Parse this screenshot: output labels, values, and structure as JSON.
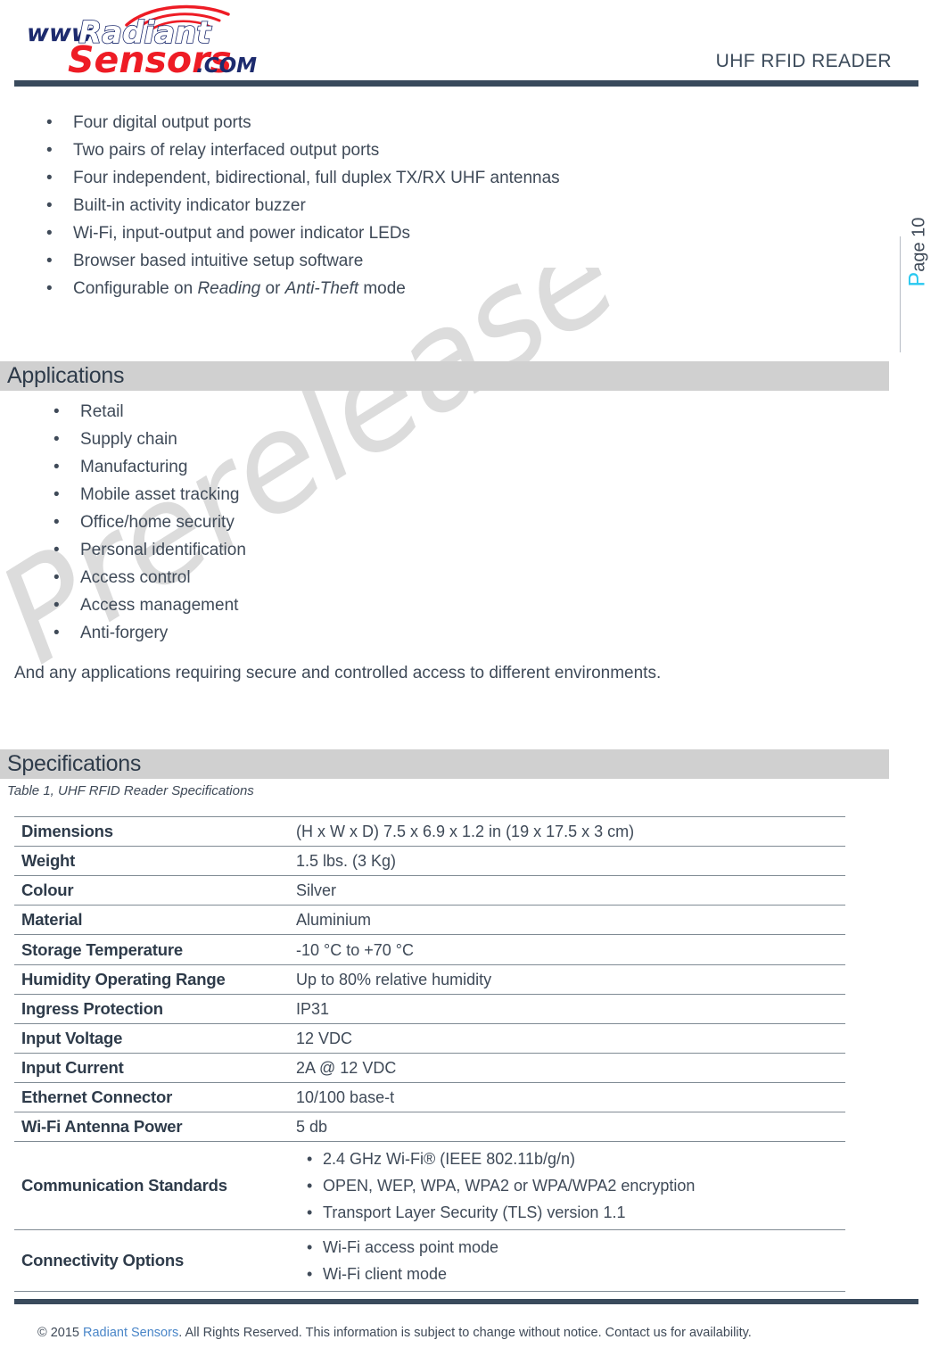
{
  "header": {
    "logo": {
      "www": "www.",
      "word1": "Radiant",
      "word2": "Sensors",
      "tld": ".COM",
      "colors": {
        "navy": "#1d2b6e",
        "red": "#ee1c25",
        "white": "#ffffff"
      }
    },
    "doc_title": "UHF RFID READER",
    "rule_color": "#394a5c"
  },
  "page_marker": {
    "prefix": "P",
    "rest": "age 10",
    "accent_color": "#28c8f0"
  },
  "watermark": {
    "text": "Prerelease Version",
    "color": "#dcdcdc"
  },
  "features": {
    "items": [
      {
        "text": "Four digital output ports"
      },
      {
        "text": "Two pairs of relay interfaced output ports"
      },
      {
        "text": "Four independent, bidirectional, full duplex TX/RX UHF antennas"
      },
      {
        "text": "Built-in activity indicator buzzer"
      },
      {
        "text": "Wi-Fi, input-output and power indicator LEDs"
      },
      {
        "text": "Browser based intuitive setup software"
      },
      {
        "pre": "Configurable on ",
        "em1": "Reading",
        "mid": " or ",
        "em2": "Anti-Theft",
        "post": " mode"
      }
    ]
  },
  "applications": {
    "heading": "Applications",
    "items": [
      "Retail",
      "Supply chain",
      "Manufacturing",
      "Mobile asset tracking",
      "Office/home security",
      "Personal identification",
      "Access control",
      "Access management",
      "Anti-forgery"
    ],
    "closing": "And any applications requiring secure and controlled access to different environments."
  },
  "specifications": {
    "heading": "Specifications",
    "caption": "Table 1, UHF RFID Reader Specifications",
    "rows": [
      {
        "label": "Dimensions",
        "value": "(H x W x D) 7.5 x 6.9 x 1.2 in (19 x 17.5 x 3 cm)"
      },
      {
        "label": "Weight",
        "value": "1.5 lbs. (3 Kg)"
      },
      {
        "label": "Colour",
        "value": "Silver"
      },
      {
        "label": "Material",
        "value": "Aluminium"
      },
      {
        "label": "Storage Temperature",
        "value": "-10 °C to +70 °C"
      },
      {
        "label": "Humidity Operating Range",
        "value": "Up to 80% relative humidity"
      },
      {
        "label": "Ingress Protection",
        "value": "IP31"
      },
      {
        "label": "Input Voltage",
        "value": "12 VDC"
      },
      {
        "label": "Input Current",
        "value": " 2A @ 12 VDC"
      },
      {
        "label": "Ethernet Connector",
        "value": "10/100 base-t"
      },
      {
        "label": "Wi-Fi Antenna Power",
        "value": " 5 db"
      },
      {
        "label": "Communication Standards",
        "bullets": [
          "2.4 GHz Wi-Fi® (IEEE 802.11b/g/n)",
          "OPEN, WEP, WPA, WPA2 or WPA/WPA2 encryption",
          "Transport Layer Security (TLS) version 1.1"
        ]
      },
      {
        "label": "Connectivity Options",
        "bullets": [
          "Wi-Fi access point mode",
          "Wi-Fi client mode"
        ]
      }
    ]
  },
  "footer": {
    "copyright": "© 2015 ",
    "link": "Radiant Sensors",
    "rest": ". All Rights Reserved. This information is subject to change without notice. Contact us for availability."
  }
}
